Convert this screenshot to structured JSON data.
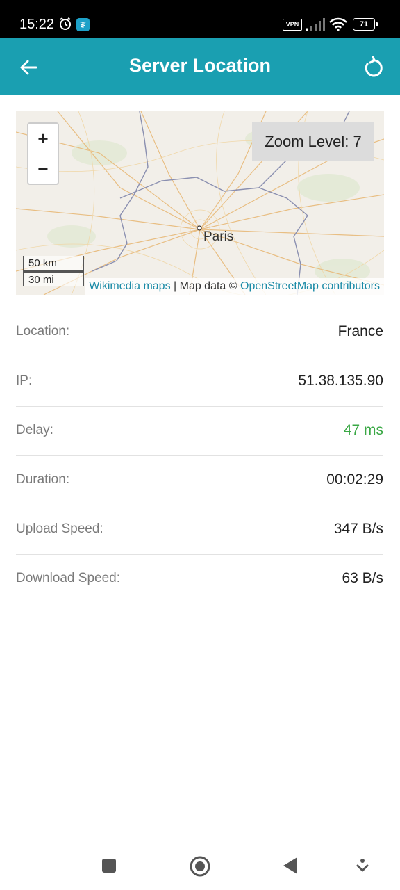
{
  "status_bar": {
    "time": "15:22",
    "vpn": "VPN",
    "battery": "71",
    "app_badge": "₮"
  },
  "appbar": {
    "title": "Server Location"
  },
  "map": {
    "zoom_in": "+",
    "zoom_out": "−",
    "zoom_label": "Zoom Level: 7",
    "city": "Paris",
    "scale_km": "50 km",
    "scale_mi": "30 mi",
    "attribution_link1": "Wikimedia maps",
    "attribution_mid": " | Map data © ",
    "attribution_link2": "OpenStreetMap contributors"
  },
  "details": [
    {
      "label": "Location:",
      "value": "France"
    },
    {
      "label": "IP:",
      "value": "51.38.135.90"
    },
    {
      "label": "Delay:",
      "value": "47 ms"
    },
    {
      "label": "Duration:",
      "value": "00:02:29"
    },
    {
      "label": "Upload Speed:",
      "value": "347 B/s"
    },
    {
      "label": "Download Speed:",
      "value": "63 B/s"
    }
  ],
  "colors": {
    "appbar": "#1a9fb1",
    "delay_green": "#3aa845",
    "link": "#1a8aa6"
  }
}
